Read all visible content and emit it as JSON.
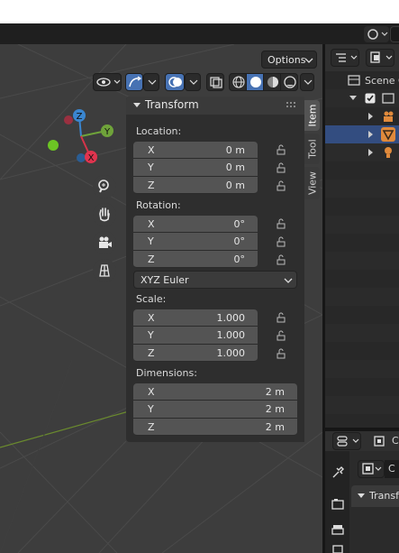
{
  "viewport": {
    "options_label": "Options",
    "gizmo_axes": [
      "X",
      "Y",
      "Z"
    ]
  },
  "npanel": {
    "title": "Transform",
    "location": {
      "label": "Location:",
      "rows": [
        {
          "axis": "X",
          "value": "0 m"
        },
        {
          "axis": "Y",
          "value": "0 m"
        },
        {
          "axis": "Z",
          "value": "0 m"
        }
      ]
    },
    "rotation": {
      "label": "Rotation:",
      "rows": [
        {
          "axis": "X",
          "value": "0°"
        },
        {
          "axis": "Y",
          "value": "0°"
        },
        {
          "axis": "Z",
          "value": "0°"
        }
      ],
      "mode": "XYZ Euler"
    },
    "scale": {
      "label": "Scale:",
      "rows": [
        {
          "axis": "X",
          "value": "1.000"
        },
        {
          "axis": "Y",
          "value": "1.000"
        },
        {
          "axis": "Z",
          "value": "1.000"
        }
      ]
    },
    "dimensions": {
      "label": "Dimensions:",
      "rows": [
        {
          "axis": "X",
          "value": "2 m"
        },
        {
          "axis": "Y",
          "value": "2 m"
        },
        {
          "axis": "Z",
          "value": "2 m"
        }
      ]
    },
    "tabs": [
      "Item",
      "Tool",
      "View"
    ]
  },
  "outliner": {
    "scene_label": "Scene C"
  },
  "properties": {
    "context_label": "C",
    "object_label": "C",
    "panel_label": "Transf"
  }
}
